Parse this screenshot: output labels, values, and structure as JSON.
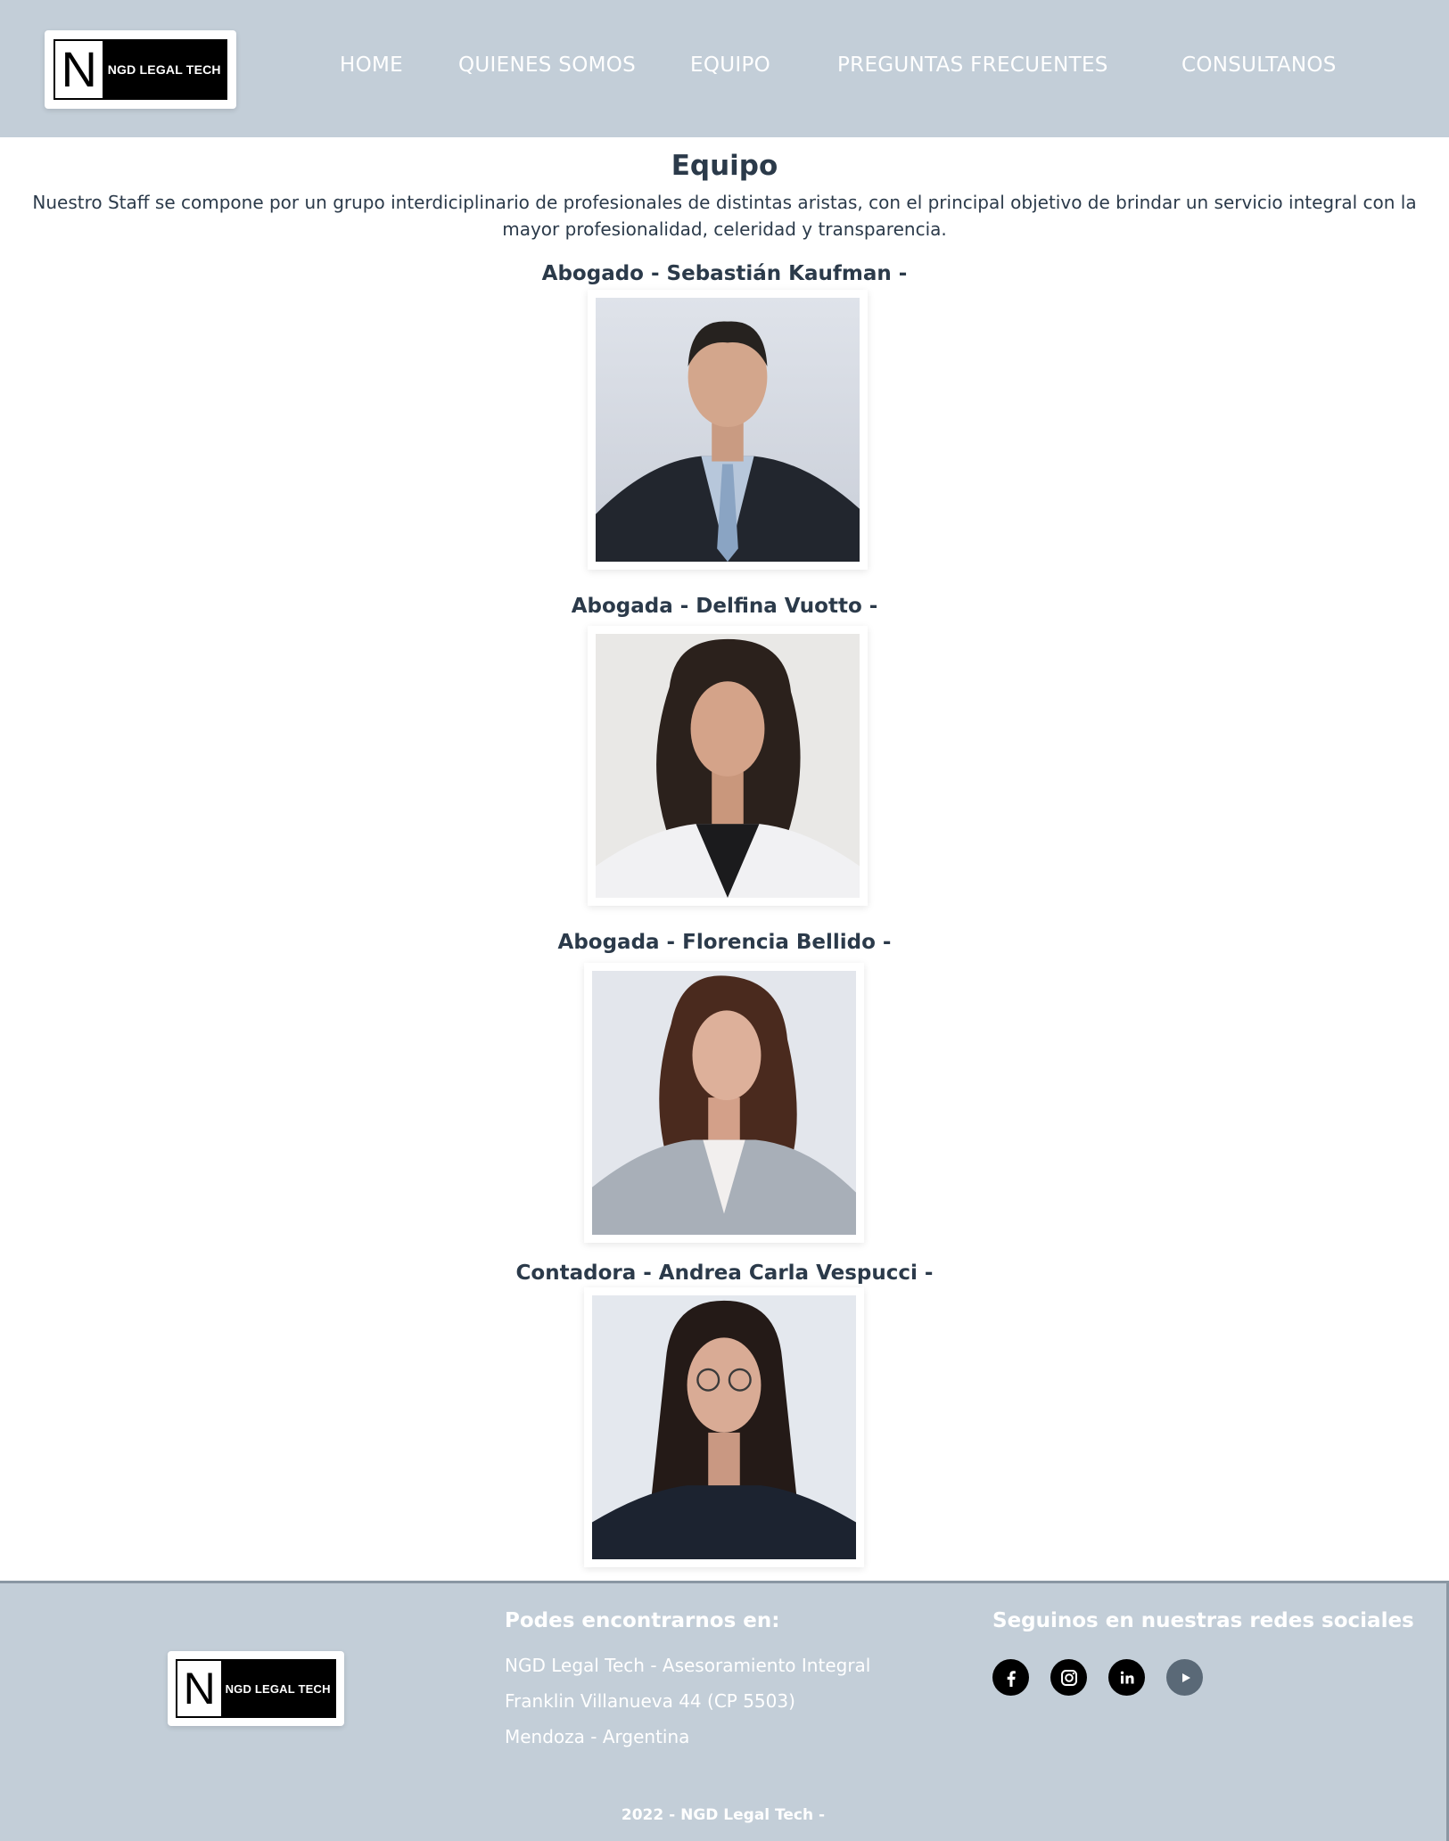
{
  "brand": {
    "logo_letter": "N",
    "logo_text": "NGD LEGAL TECH"
  },
  "nav": {
    "home": "HOME",
    "quienes": "QUIENES SOMOS",
    "equipo": "EQUIPO",
    "preguntas": "PREGUNTAS FRECUENTES",
    "consultanos": "CONSULTANOS"
  },
  "main": {
    "title": "Equipo",
    "intro": "Nuestro Staff se compone por un grupo interdiciplinario de profesionales de distintas aristas, con el principal objetivo de brindar un servicio integral con la mayor profesionalidad, celeridad y transparencia.",
    "members": [
      {
        "name": "Abogado - Sebastián Kaufman -"
      },
      {
        "name": "Abogada - Delfina Vuotto -"
      },
      {
        "name": "Abogada - Florencia Bellido -"
      },
      {
        "name": "Contadora - Andrea Carla Vespucci -"
      }
    ]
  },
  "footer": {
    "location_heading": "Podes encontrarnos en:",
    "address_lines": [
      "NGD Legal Tech - Asesoramiento Integral",
      "Franklin Villanueva 44 (CP 5503)",
      "Mendoza - Argentina"
    ],
    "social_heading": "Seguinos en nuestras redes sociales",
    "social": [
      "facebook-icon",
      "instagram-icon",
      "linkedin-icon",
      "youtube-icon"
    ],
    "copyright": "2022 - NGD Legal Tech -"
  },
  "colors": {
    "header_bg": "#c3ced8",
    "text": "#2b3a4a"
  }
}
